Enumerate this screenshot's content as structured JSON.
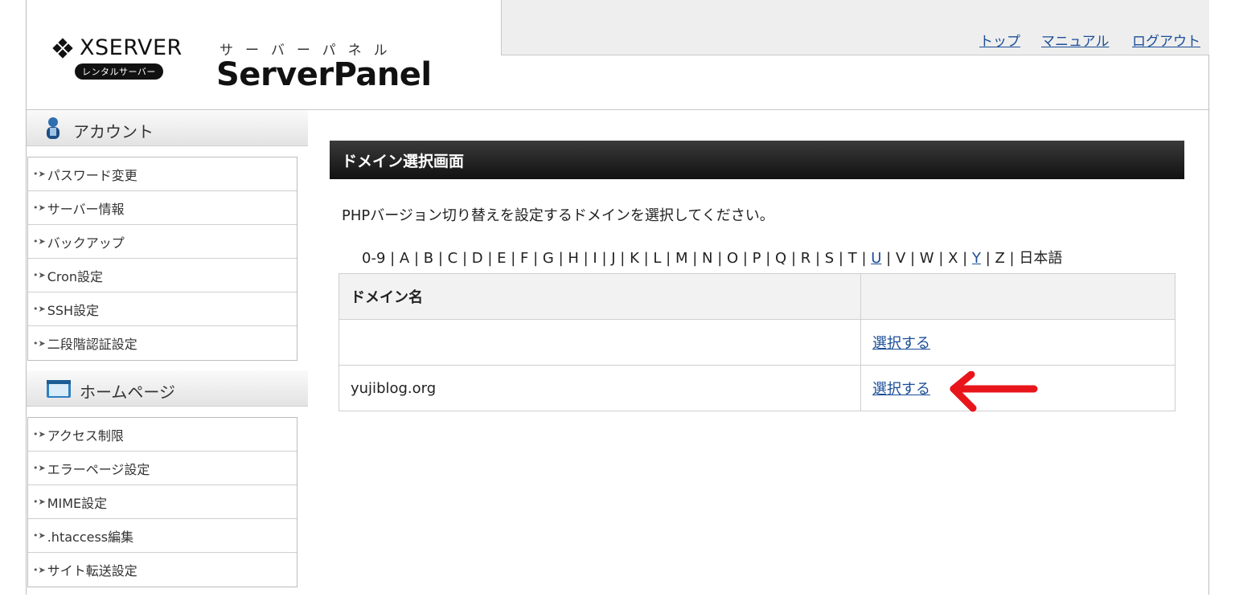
{
  "header": {
    "brand": "XSERVER",
    "brand_sub": "レンタルサーバー",
    "panel_kana": "サーバーパネル",
    "panel_title": "ServerPanel",
    "nav": [
      "トップ",
      "マニュアル",
      "ログアウト"
    ]
  },
  "sidebar": {
    "sections": [
      {
        "title": "アカウント",
        "icon": "person-icon",
        "items": [
          "パスワード変更",
          "サーバー情報",
          "バックアップ",
          "Cron設定",
          "SSH設定",
          "二段階認証設定"
        ]
      },
      {
        "title": "ホームページ",
        "icon": "window-icon",
        "items": [
          "アクセス制限",
          "エラーページ設定",
          "MIME設定",
          ".htaccess編集",
          "サイト転送設定"
        ]
      }
    ]
  },
  "main": {
    "heading": "ドメイン選択画面",
    "description": "PHPバージョン切り替えを設定するドメインを選択してください。",
    "index_letters": [
      "0-9",
      "A",
      "B",
      "C",
      "D",
      "E",
      "F",
      "G",
      "H",
      "I",
      "J",
      "K",
      "L",
      "M",
      "N",
      "O",
      "P",
      "Q",
      "R",
      "S",
      "T",
      "U",
      "V",
      "W",
      "X",
      "Y",
      "Z",
      "日本語"
    ],
    "linked_letters": [
      "U",
      "Y"
    ],
    "table": {
      "headers": [
        "ドメイン名",
        ""
      ],
      "rows": [
        {
          "domain": "",
          "action": "選択する"
        },
        {
          "domain": "yujiblog.org",
          "action": "選択する"
        }
      ]
    },
    "annotation": {
      "icon": "red-arrow-icon",
      "color": "#e8151b"
    }
  }
}
